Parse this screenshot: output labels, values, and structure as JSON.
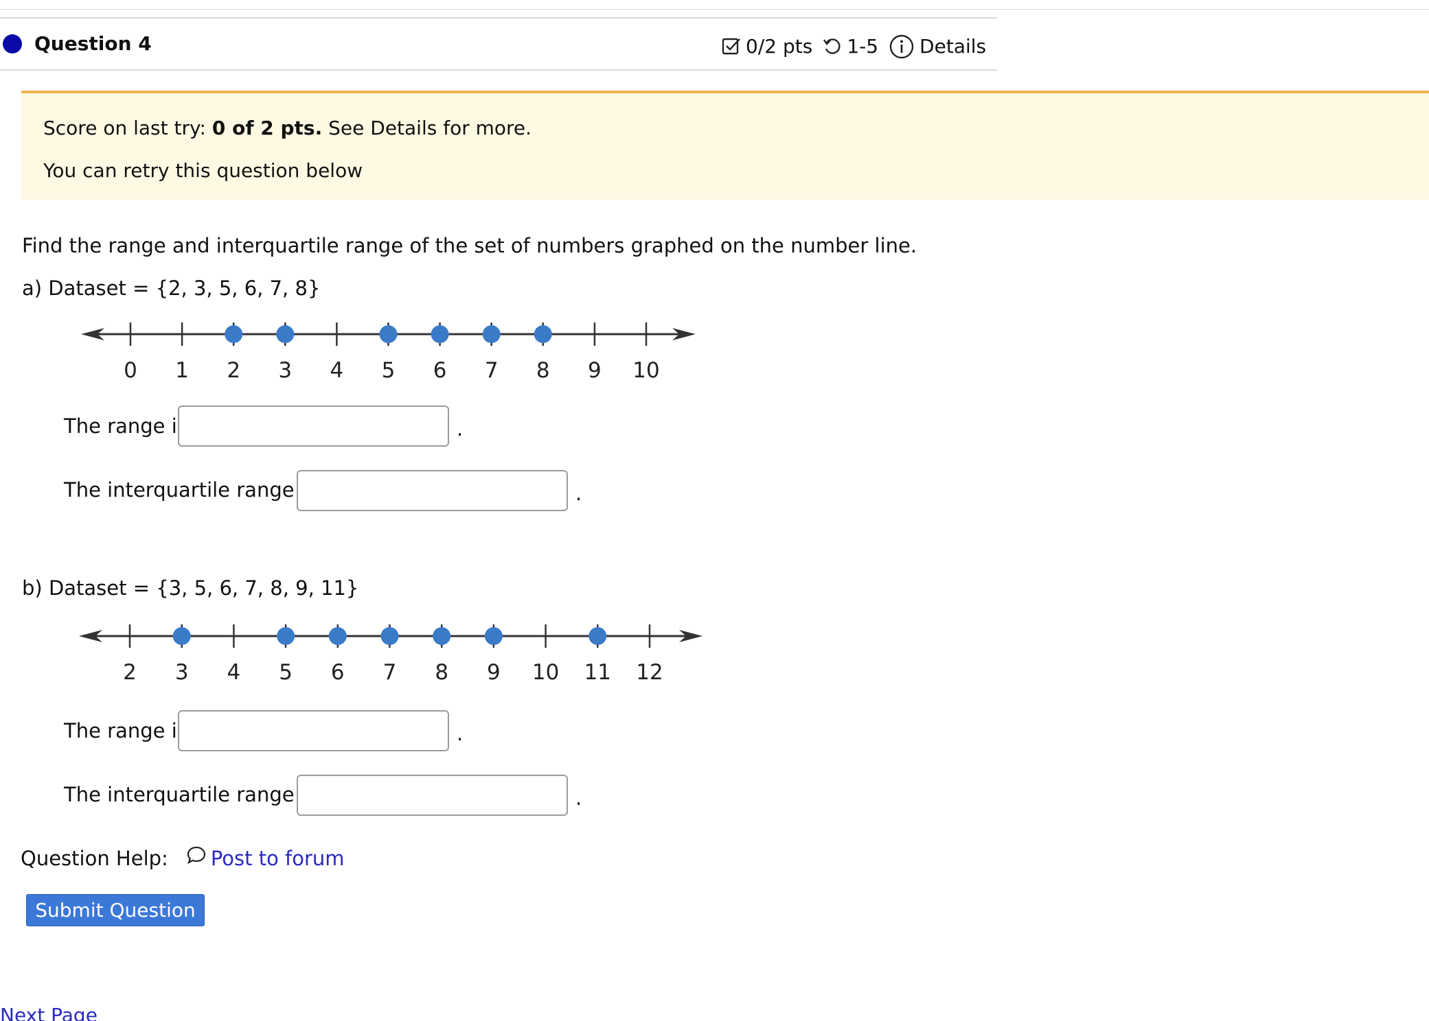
{
  "question": {
    "title": "Question 4",
    "points": "0/2 pts",
    "attempts": "1-5",
    "details_label": "Details",
    "icons": [
      "checkbox-icon",
      "retry-icon",
      "info-icon"
    ],
    "status_dot_color": "#0a0aa8"
  },
  "banner": {
    "score_prefix": "Score on last try: ",
    "score_value": "0 of 2 pts.",
    "score_suffix": " See Details for more.",
    "retry_text": "You can retry this question below"
  },
  "prompt": "Find the range and interquartile range of the set of numbers graphed on the number line.",
  "parts": [
    {
      "heading": "a)  Dataset = {2, 3, 5, 6, 7, 8}",
      "number_line": {
        "ticks": [
          0,
          1,
          2,
          3,
          4,
          5,
          6,
          7,
          8,
          9,
          10
        ],
        "points": [
          2,
          3,
          5,
          6,
          7,
          8
        ]
      },
      "range_label": "The range is",
      "range_value": "",
      "iqr_label": "The interquartile range is",
      "iqr_value": "",
      "period": "."
    },
    {
      "heading": "b)  Dataset = {3, 5, 6, 7, 8, 9, 11}",
      "number_line": {
        "ticks": [
          2,
          3,
          4,
          5,
          6,
          7,
          8,
          9,
          10,
          11,
          12
        ],
        "points": [
          3,
          5,
          6,
          7,
          8,
          9,
          11
        ]
      },
      "range_label": "The range is",
      "range_value": "",
      "iqr_label": "The interquartile range is",
      "iqr_value": "",
      "period": "."
    }
  ],
  "help": {
    "label": "Question Help:",
    "link_label": "Post to forum",
    "icon": "chat-bubble-icon"
  },
  "submit_label": "Submit Question",
  "next_page_label": "Next Page",
  "colors": {
    "banner_bg": "#fef9e3",
    "banner_border": "#f0b54d",
    "dot_blue": "#3a7bc8",
    "link": "#2a2ac0",
    "submit_bg": "#3b78d8"
  }
}
